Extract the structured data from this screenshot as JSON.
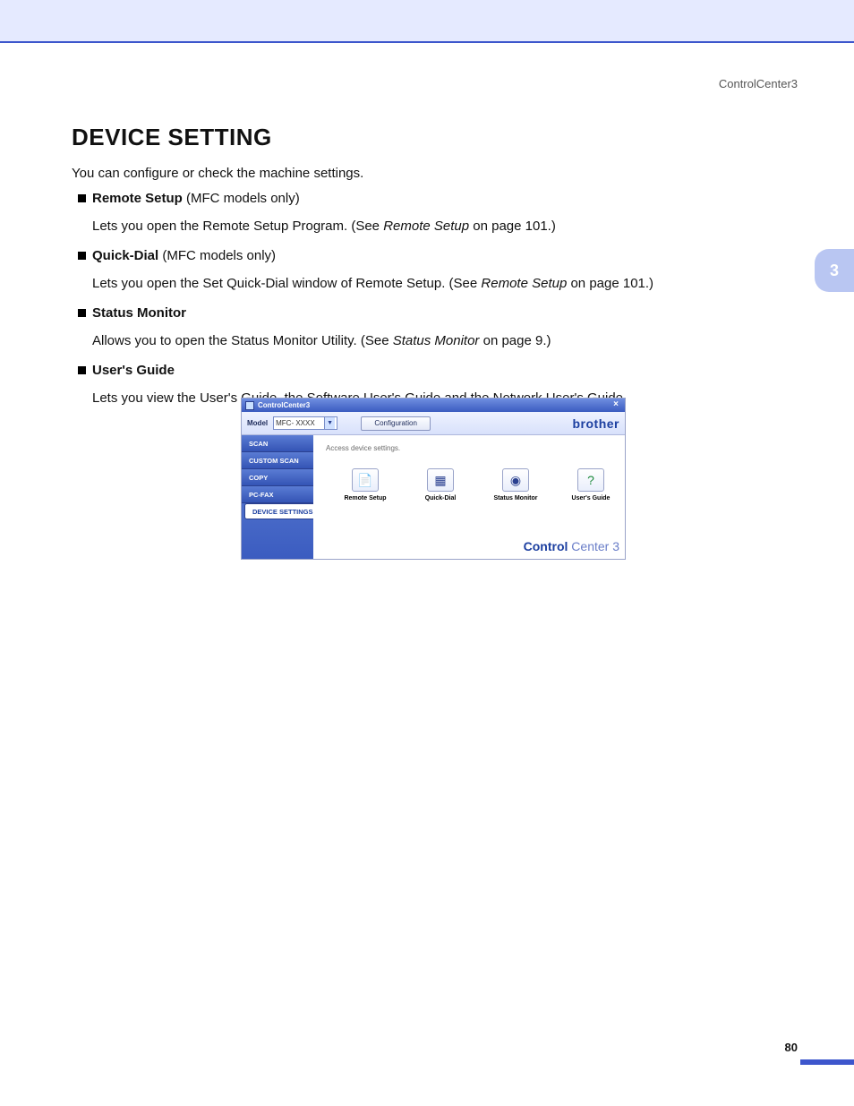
{
  "header": {
    "product": "ControlCenter3"
  },
  "section": {
    "title": "DEVICE SETTING",
    "intro": "You can configure or check the machine settings."
  },
  "bullets": [
    {
      "title": "Remote Setup",
      "note": " (MFC models only)",
      "desc_pre": "Lets you open the Remote Setup Program. (See ",
      "desc_ref": "Remote Setup",
      "desc_post": " on page 101.)"
    },
    {
      "title": "Quick-Dial",
      "note": " (MFC models only)",
      "desc_pre": "Lets you open the Set Quick-Dial window of Remote Setup. (See ",
      "desc_ref": "Remote Setup",
      "desc_post": " on page 101.)"
    },
    {
      "title": "Status Monitor",
      "desc_pre": "Allows you to open the Status Monitor Utility. (See ",
      "desc_ref": "Status Monitor",
      "desc_post": " on page 9.)"
    },
    {
      "title": "User's Guide",
      "desc": "Lets you view the User's Guide, the Software User's Guide and the Network User's Guide."
    }
  ],
  "app": {
    "title": "ControlCenter3",
    "model_label": "Model",
    "model_value": "MFC- XXXX",
    "config_btn": "Configuration",
    "brand": "brother",
    "sidebar": [
      "SCAN",
      "CUSTOM SCAN",
      "COPY",
      "PC-FAX",
      "DEVICE SETTINGS"
    ],
    "panel_caption": "Access device settings.",
    "icons": [
      "Remote Setup",
      "Quick-Dial",
      "Status Monitor",
      "User's Guide"
    ],
    "footer_brand": {
      "bold": "Control",
      "thin": " Center 3"
    }
  },
  "page": {
    "chapter": "3",
    "number": "80"
  }
}
